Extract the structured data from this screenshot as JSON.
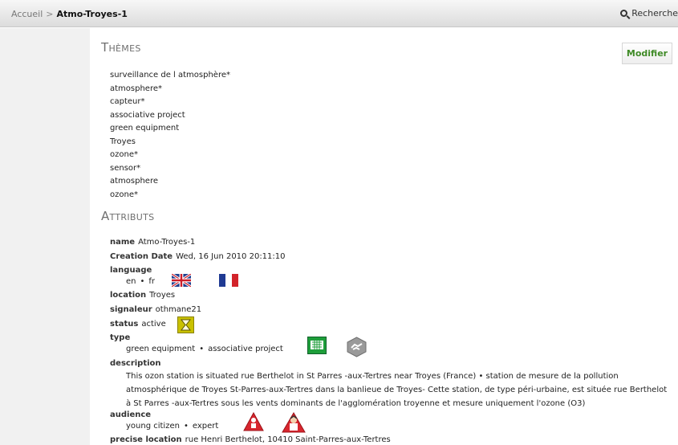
{
  "breadcrumb": {
    "home": "Accueil",
    "separator": ">",
    "current": "Atmo-Troyes-1"
  },
  "search": {
    "label": "Recherche",
    "icon": "search-icon"
  },
  "modify_button": {
    "label": "Modifier",
    "color": "#3f8a26"
  },
  "themes": {
    "title": "Thèmes",
    "items": [
      "surveillance de l atmosphère*",
      "atmosphere*",
      "capteur*",
      "associative project",
      "green equipment",
      "Troyes",
      "ozone*",
      "sensor*",
      "atmosphere",
      "ozone*"
    ]
  },
  "attributes": {
    "title": "Attributs",
    "name": {
      "key": "name",
      "value": "Atmo-Troyes-1"
    },
    "creation_date": {
      "key": "Creation Date",
      "value": "Wed, 16 Jun 2010 20:11:10"
    },
    "language": {
      "key": "language",
      "values": [
        "en",
        "fr"
      ],
      "icons": [
        "uk-flag-icon",
        "france-flag-icon"
      ]
    },
    "location": {
      "key": "location",
      "value": "Troyes"
    },
    "signaleur": {
      "key": "signaleur",
      "value": "othmane21"
    },
    "status": {
      "key": "status",
      "value": "active",
      "icon": "hourglass-icon"
    },
    "type": {
      "key": "type",
      "values": [
        "green equipment",
        "associative project"
      ],
      "icons": [
        "green-equipment-icon",
        "handshake-icon"
      ]
    },
    "description": {
      "key": "description",
      "line1": "This ozon station is situated rue Berthelot in St Parres -aux-Tertres near Troyes (France)  •  station de mesure de la pollution",
      "line2": "atmosphérique de Troyes St-Parres-aux-Tertres dans la banlieue de Troyes- Cette station, de type péri-urbaine, est située rue Berthelot",
      "line3": "à St Parres -aux-Tertres sous les vents dominants de l'agglomération troyenne et mesure uniquement l'ozone (O3)"
    },
    "audience": {
      "key": "audience",
      "values": [
        "young citizen",
        "expert"
      ],
      "icons": [
        "warning-icon",
        "expert-icon"
      ]
    },
    "precise_location": {
      "key": "precise location",
      "value": "rue Henri Berthelot, 10410 Saint-Parres-aux-Tertres"
    }
  },
  "bullet": "•"
}
